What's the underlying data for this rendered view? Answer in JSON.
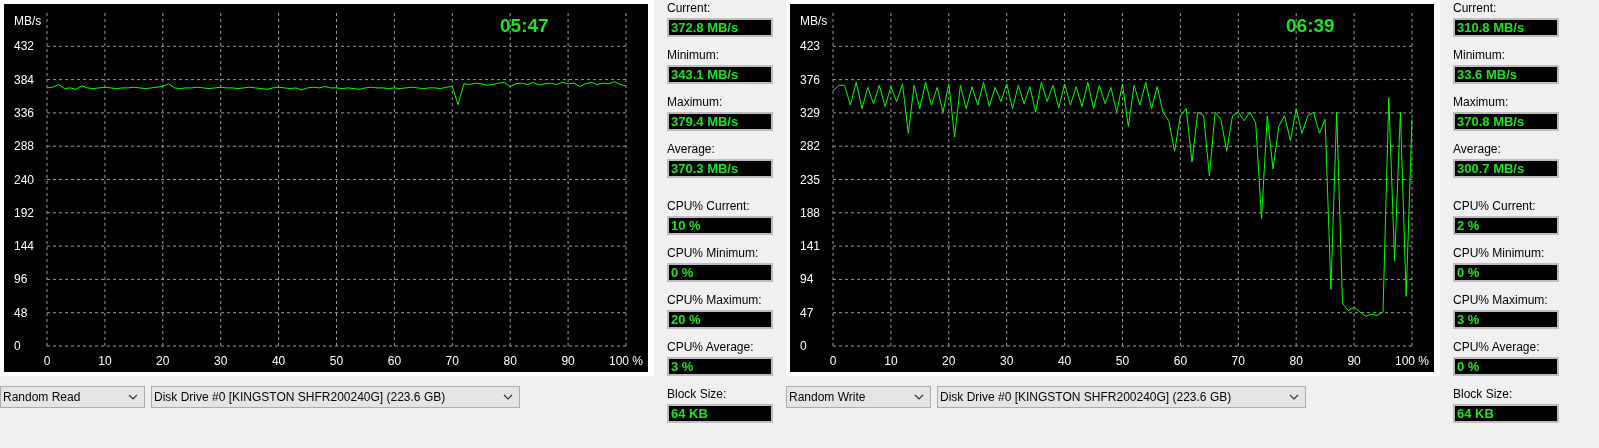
{
  "panels": [
    {
      "time": "05:47",
      "unit": "MB/s",
      "chart_data": {
        "type": "line",
        "xlim": [
          0,
          100
        ],
        "ylim": [
          0,
          480
        ],
        "x": [
          0,
          1,
          2,
          3,
          4,
          5,
          6,
          7,
          8,
          9,
          10,
          11,
          12,
          13,
          14,
          15,
          16,
          17,
          18,
          19,
          20,
          21,
          22,
          23,
          24,
          25,
          26,
          27,
          28,
          29,
          30,
          31,
          32,
          33,
          34,
          35,
          36,
          37,
          38,
          39,
          40,
          41,
          42,
          43,
          44,
          45,
          46,
          47,
          48,
          49,
          50,
          51,
          52,
          53,
          54,
          55,
          56,
          57,
          58,
          59,
          60,
          61,
          62,
          63,
          64,
          65,
          66,
          67,
          68,
          69,
          70,
          71,
          72,
          73,
          74,
          75,
          76,
          77,
          78,
          79,
          80,
          81,
          82,
          83,
          84,
          85,
          86,
          87,
          88,
          89,
          90,
          91,
          92,
          93,
          94,
          95,
          96,
          97,
          98,
          99,
          100
        ],
        "series": [
          {
            "color": "#00ff00",
            "values": [
              372,
              373,
              377,
              371,
              372,
              370,
              375,
              372,
              371,
              372,
              373,
              372,
              371,
              372,
              372,
              373,
              372,
              371,
              372,
              373,
              374,
              378,
              372,
              371,
              372,
              372,
              373,
              372,
              371,
              372,
              373,
              372,
              372,
              371,
              372,
              373,
              372,
              371,
              370,
              372,
              373,
              372,
              371,
              372,
              369,
              372,
              373,
              372,
              374,
              372,
              372,
              371,
              372,
              371,
              370,
              372,
              373,
              372,
              372,
              371,
              372,
              371,
              372,
              373,
              372,
              371,
              372,
              372,
              371,
              373,
              374,
              348,
              378,
              377,
              379,
              378,
              376,
              377,
              379,
              380,
              374,
              378,
              379,
              377,
              380,
              376,
              378,
              379,
              377,
              380,
              378,
              379,
              374,
              378,
              380,
              377,
              379,
              378,
              381,
              377,
              375
            ]
          }
        ],
        "xticks": [
          0,
          10,
          20,
          30,
          40,
          50,
          60,
          70,
          80,
          90,
          {
            "value": 100,
            "label": "100 %"
          }
        ],
        "yticks": [
          0,
          48,
          96,
          144,
          192,
          240,
          288,
          336,
          384,
          432
        ],
        "grid": true
      },
      "test": "Random Read",
      "drive": "Disk Drive #0  [KINGSTON SHFR200240G]  (223.6 GB)",
      "stats": [
        {
          "label": "Current:",
          "value": "372.8 MB/s"
        },
        {
          "label": "Minimum:",
          "value": "343.1 MB/s"
        },
        {
          "label": "Maximum:",
          "value": "379.4 MB/s"
        },
        {
          "label": "Average:",
          "value": "370.3 MB/s"
        }
      ],
      "cpu_stats": [
        {
          "label": "CPU% Current:",
          "value": "10 %"
        },
        {
          "label": "CPU% Minimum:",
          "value": "0 %"
        },
        {
          "label": "CPU% Maximum:",
          "value": "20 %"
        },
        {
          "label": "CPU% Average:",
          "value": "3 %"
        },
        {
          "label": "Block Size:",
          "value": "64 KB"
        }
      ]
    },
    {
      "time": "06:39",
      "unit": "MB/s",
      "chart_data": {
        "type": "line",
        "xlim": [
          0,
          100
        ],
        "ylim": [
          0,
          470
        ],
        "x": [
          0,
          1,
          2,
          3,
          4,
          5,
          6,
          7,
          8,
          9,
          10,
          11,
          12,
          13,
          14,
          15,
          16,
          17,
          18,
          19,
          20,
          21,
          22,
          23,
          24,
          25,
          26,
          27,
          28,
          29,
          30,
          31,
          32,
          33,
          34,
          35,
          36,
          37,
          38,
          39,
          40,
          41,
          42,
          43,
          44,
          45,
          46,
          47,
          48,
          49,
          50,
          51,
          52,
          53,
          54,
          55,
          56,
          57,
          58,
          59,
          60,
          61,
          62,
          63,
          64,
          65,
          66,
          67,
          68,
          69,
          70,
          71,
          72,
          73,
          74,
          75,
          76,
          77,
          78,
          79,
          80,
          81,
          82,
          83,
          84,
          85,
          86,
          87,
          88,
          89,
          90,
          91,
          92,
          93,
          94,
          95,
          96,
          97,
          98,
          99,
          100
        ],
        "series": [
          {
            "color": "#00ff00",
            "values": [
              360,
              368,
              368,
              340,
              372,
              335,
              365,
              342,
              368,
              338,
              366,
              345,
              370,
              300,
              368,
              335,
              372,
              340,
              365,
              330,
              370,
              295,
              368,
              335,
              366,
              340,
              372,
              338,
              365,
              345,
              370,
              335,
              368,
              342,
              366,
              330,
              372,
              345,
              368,
              336,
              370,
              340,
              366,
              338,
              372,
              335,
              368,
              342,
              365,
              330,
              370,
              310,
              368,
              340,
              372,
              335,
              366,
              330,
              318,
              275,
              325,
              335,
              260,
              330,
              325,
              240,
              330,
              320,
              275,
              325,
              330,
              318,
              330,
              315,
              180,
              325,
              250,
              310,
              325,
              290,
              335,
              300,
              325,
              330,
              300,
              320,
              80,
              330,
              60,
              50,
              55,
              48,
              42,
              45,
              43,
              48,
              350,
              120,
              330,
              70,
              320
            ]
          }
        ],
        "xticks": [
          0,
          10,
          20,
          30,
          40,
          50,
          60,
          70,
          80,
          90,
          {
            "value": 100,
            "label": "100 %"
          }
        ],
        "yticks": [
          0,
          47,
          94,
          141,
          188,
          235,
          282,
          329,
          376,
          423
        ],
        "grid": true
      },
      "test": "Random Write",
      "drive": "Disk Drive #0  [KINGSTON SHFR200240G]  (223.6 GB)",
      "stats": [
        {
          "label": "Current:",
          "value": "310.8 MB/s"
        },
        {
          "label": "Minimum:",
          "value": "33.6 MB/s"
        },
        {
          "label": "Maximum:",
          "value": "370.8 MB/s"
        },
        {
          "label": "Average:",
          "value": "300.7 MB/s"
        }
      ],
      "cpu_stats": [
        {
          "label": "CPU% Current:",
          "value": "2 %"
        },
        {
          "label": "CPU% Minimum:",
          "value": "0 %"
        },
        {
          "label": "CPU% Maximum:",
          "value": "3 %"
        },
        {
          "label": "CPU% Average:",
          "value": "0 %"
        },
        {
          "label": "Block Size:",
          "value": "64 KB"
        }
      ]
    }
  ]
}
